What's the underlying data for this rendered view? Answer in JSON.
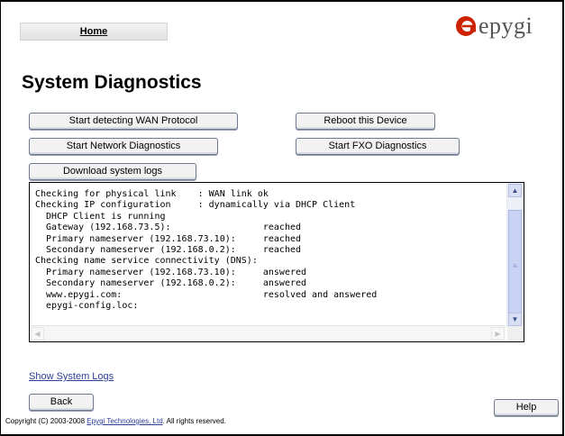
{
  "nav": {
    "home_label": "Home"
  },
  "logo": {
    "text": "epygi"
  },
  "page": {
    "title": "System Diagnostics"
  },
  "buttons": {
    "detect_wan": "Start detecting WAN Protocol",
    "reboot": "Reboot this Device",
    "network_diag": "Start Network Diagnostics",
    "fxo_diag": "Start FXO Diagnostics",
    "download_logs": "Download system logs",
    "back": "Back",
    "help": "Help"
  },
  "log": {
    "lines": [
      "Checking for physical link    : WAN link ok",
      "Checking IP configuration     : dynamically via DHCP Client",
      "  DHCP Client is running",
      "  Gateway (192.168.73.5):                 reached",
      "  Primary nameserver (192.168.73.10):     reached",
      "  Secondary nameserver (192.168.0.2):     reached",
      "Checking name service connectivity (DNS):",
      "  Primary nameserver (192.168.73.10):     answered",
      "  Secondary nameserver (192.168.0.2):     answered",
      "  www.epygi.com:                          resolved and answered",
      "  epygi-config.loc:"
    ]
  },
  "links": {
    "show_logs": "Show System Logs"
  },
  "footer": {
    "prefix": "Copyright (C) 2003-2008 ",
    "company": "Epygi Technologies, Ltd",
    "suffix": ". All rights reserved."
  },
  "colors": {
    "logo_red": "#cc2200",
    "link": "#2c3e9a",
    "button_border": "#6f7a8f"
  }
}
